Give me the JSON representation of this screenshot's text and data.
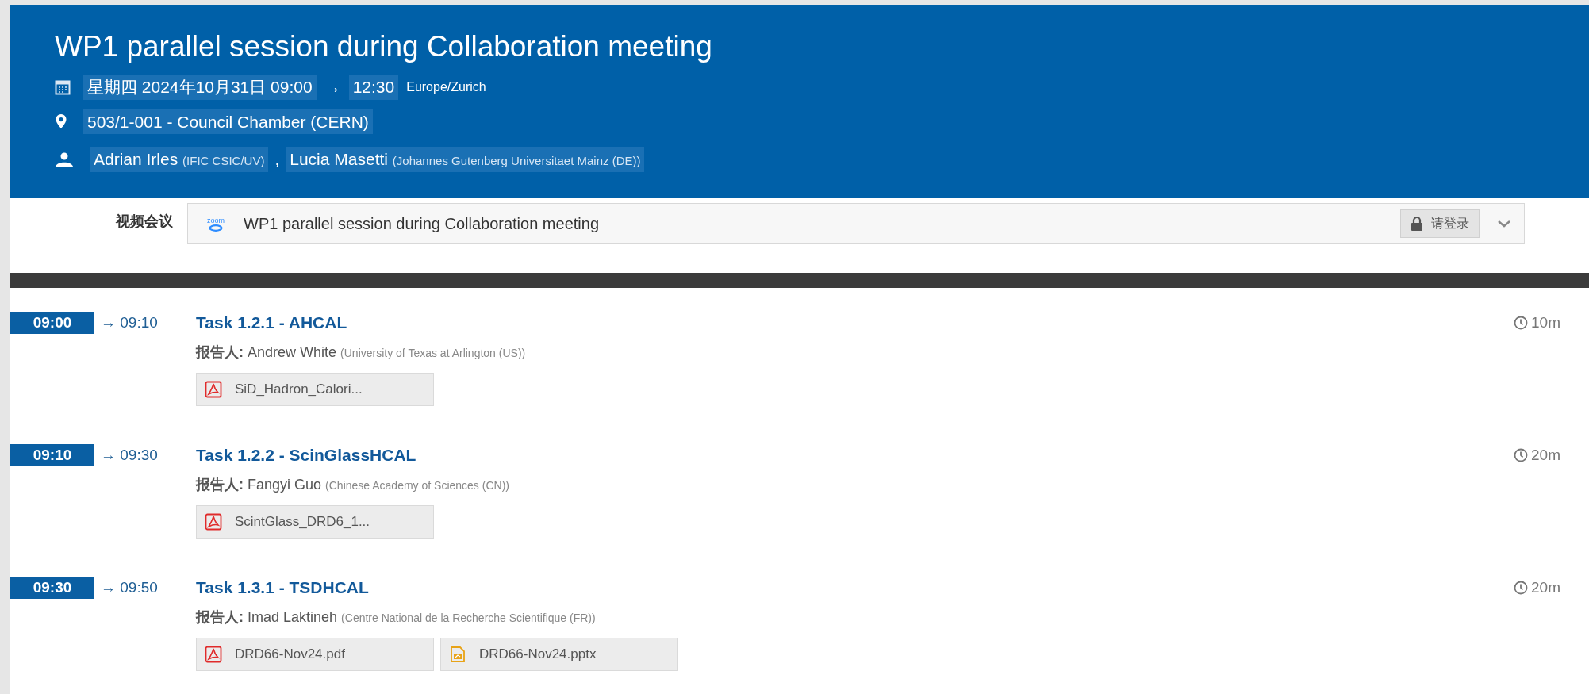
{
  "event": {
    "title": "WP1 parallel session during Collaboration meeting",
    "date": {
      "start": "星期四 2024年10月31日 09:00",
      "arrow": "→",
      "end": "12:30",
      "timezone": "Europe/Zurich"
    },
    "location": "503/1-001 - Council Chamber (CERN)",
    "chairs": [
      {
        "name": "Adrian Irles",
        "affiliation": "(IFIC CSIC/UV)"
      },
      {
        "name": "Lucia Masetti",
        "affiliation": "(Johannes Gutenberg Universitaet Mainz (DE))"
      }
    ],
    "chairs_separator": ","
  },
  "videoconference": {
    "label": "视频会议",
    "logo_text": "zoom",
    "room": "WP1 parallel session during Collaboration meeting",
    "login": "请登录"
  },
  "contributions": [
    {
      "start": "09:00",
      "end": "→ 09:10",
      "title": "Task 1.2.1 - AHCAL",
      "speaker_label": "报告人:",
      "speaker": "Andrew White",
      "affiliation": "(University of Texas at Arlington (US))",
      "duration": "10m",
      "attachments": [
        {
          "kind": "pdf",
          "name": "SiD_Hadron_Calori..."
        }
      ]
    },
    {
      "start": "09:10",
      "end": "→ 09:30",
      "title": "Task 1.2.2 - ScinGlassHCAL",
      "speaker_label": "报告人:",
      "speaker": "Fangyi Guo",
      "affiliation": "(Chinese Academy of Sciences (CN))",
      "duration": "20m",
      "attachments": [
        {
          "kind": "pdf",
          "name": "ScintGlass_DRD6_1..."
        }
      ]
    },
    {
      "start": "09:30",
      "end": "→ 09:50",
      "title": "Task 1.3.1 - TSDHCAL",
      "speaker_label": "报告人:",
      "speaker": "Imad Laktineh",
      "affiliation": "(Centre National de la Recherche Scientifique (FR))",
      "duration": "20m",
      "attachments": [
        {
          "kind": "pdf",
          "name": "DRD66-Nov24.pdf"
        },
        {
          "kind": "pptx",
          "name": "DRD66-Nov24.pptx"
        }
      ]
    }
  ]
}
